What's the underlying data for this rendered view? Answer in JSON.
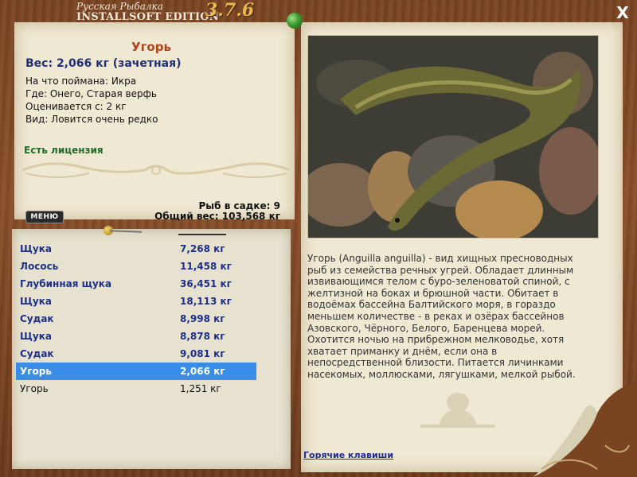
{
  "app": {
    "logo_line1": "Русская Рыбалка",
    "logo_line2": "INSTALLSOFT EDITION",
    "version": "3.7.6",
    "close_label": "X"
  },
  "catch": {
    "name": "Угорь",
    "weight": "Вес: 2,066 кг (зачетная)",
    "bait": "На что поймана: Икра",
    "location": "Где: Онего, Старая верфь",
    "rated_from": "Оценивается с: 2 кг",
    "rarity": "Вид: Ловится очень редко",
    "license": "Есть лицензия"
  },
  "cage": {
    "count": "Рыб в садке: 9",
    "total": "Общий вес: 103,568 кг"
  },
  "menu_label": "МЕНЮ",
  "fish_list": [
    {
      "name": "Щука",
      "weight": "7,268 кг"
    },
    {
      "name": "Лосось",
      "weight": "11,458 кг"
    },
    {
      "name": "Глубинная щука",
      "weight": "36,451 кг"
    },
    {
      "name": "Щука",
      "weight": "18,113 кг"
    },
    {
      "name": "Судак",
      "weight": "8,998 кг"
    },
    {
      "name": "Щука",
      "weight": "8,878 кг"
    },
    {
      "name": "Судак",
      "weight": "9,081 кг"
    },
    {
      "name": "Угорь",
      "weight": "2,066 кг"
    },
    {
      "name": "Угорь",
      "weight": "1,251 кг"
    }
  ],
  "description": "Угорь (Anguilla anguilla) - вид хищных пресноводных рыб из семейства речных угрей. Обладает длинным извивающимся телом с буро-зеленоватой спиной, с желтизной на боках и брюшной части. Обитает в водоёмах бассейна Балтийского моря, в гораздо меньшем количестве - в реках и озёрах бассейнов Азовского, Чёрного, Белого, Баренцева морей. Охотится ночью на прибрежном мелководье, хотя хватает приманку и днём, если она в непосредственной близости. Питается личинками насекомых, моллюсками, лягушками, мелкой рыбой.",
  "hotkeys_label": "Горячие клавиши",
  "colors": {
    "accent_title": "#b1441b",
    "list_text": "#1d2f8a",
    "selection": "#3a8de6",
    "license": "#1f6d2a"
  }
}
